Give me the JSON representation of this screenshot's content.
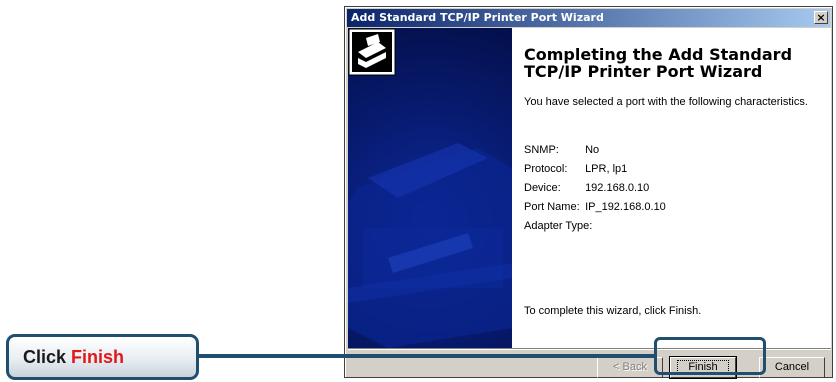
{
  "window": {
    "title": "Add Standard TCP/IP Printer Port Wizard",
    "close_glyph": "×"
  },
  "heading": "Completing the Add Standard TCP/IP Printer Port Wizard",
  "subtext": "You have selected a port with the following characteristics.",
  "properties": [
    {
      "label": "SNMP:",
      "value": "No"
    },
    {
      "label": "Protocol:",
      "value": "LPR, lp1"
    },
    {
      "label": "Device:",
      "value": "192.168.0.10"
    },
    {
      "label": "Port Name:",
      "value": "IP_192.168.0.10"
    },
    {
      "label": "Adapter Type:",
      "value": ""
    }
  ],
  "finish_instruction": "To complete this wizard, click Finish.",
  "buttons": {
    "back": "< Back",
    "finish": "Finish",
    "cancel": "Cancel"
  },
  "callout": {
    "prefix": "Click ",
    "accent": "Finish"
  },
  "colors": {
    "title_start": "#0a246a",
    "callout_border": "#1f4e6e",
    "callout_accent": "#e01818",
    "panel_blue": "#071a6e"
  },
  "icons": {
    "wizard": "printer-wizard-icon",
    "close": "close-icon"
  }
}
